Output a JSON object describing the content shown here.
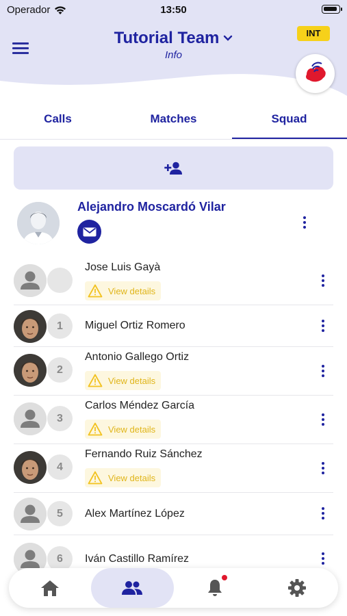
{
  "status_bar": {
    "carrier": "Operador",
    "time": "13:50"
  },
  "header": {
    "team_name": "Tutorial Team",
    "subtitle": "Info",
    "badge": "INT",
    "menu_icon": "hamburger-menu-icon",
    "dropdown_icon": "chevron-down-icon"
  },
  "tabs": [
    {
      "label": "Calls",
      "active": false
    },
    {
      "label": "Matches",
      "active": false
    },
    {
      "label": "Squad",
      "active": true
    }
  ],
  "add_player": {
    "icon": "add-person-icon"
  },
  "coach": {
    "name": "Alejandro Moscardó Vilar",
    "icon": "mail-icon"
  },
  "players": [
    {
      "name": "Jose Luis Gayà",
      "number": "",
      "photo": false,
      "warning": "View details"
    },
    {
      "name": "Miguel Ortiz Romero",
      "number": "1",
      "photo": true,
      "warning": ""
    },
    {
      "name": "Antonio Gallego Ortiz",
      "number": "2",
      "photo": true,
      "warning": "View details"
    },
    {
      "name": "Carlos Méndez García",
      "number": "3",
      "photo": false,
      "warning": "View details"
    },
    {
      "name": "Fernando Ruiz Sánchez",
      "number": "4",
      "photo": true,
      "warning": "View details"
    },
    {
      "name": "Alex Martínez López",
      "number": "5",
      "photo": false,
      "warning": ""
    },
    {
      "name": "Iván Castillo Ramírez",
      "number": "6",
      "photo": false,
      "warning": ""
    }
  ],
  "bottom_nav": [
    {
      "icon": "home-icon",
      "active": false
    },
    {
      "icon": "team-icon",
      "active": true
    },
    {
      "icon": "bell-icon",
      "active": false,
      "has_notification": true
    },
    {
      "icon": "gear-icon",
      "active": false
    }
  ],
  "colors": {
    "primary": "#1f23a0",
    "header_bg": "#e2e3f5",
    "badge": "#f6d11a",
    "warning": "#e0b51a",
    "notification": "#e0182d"
  }
}
